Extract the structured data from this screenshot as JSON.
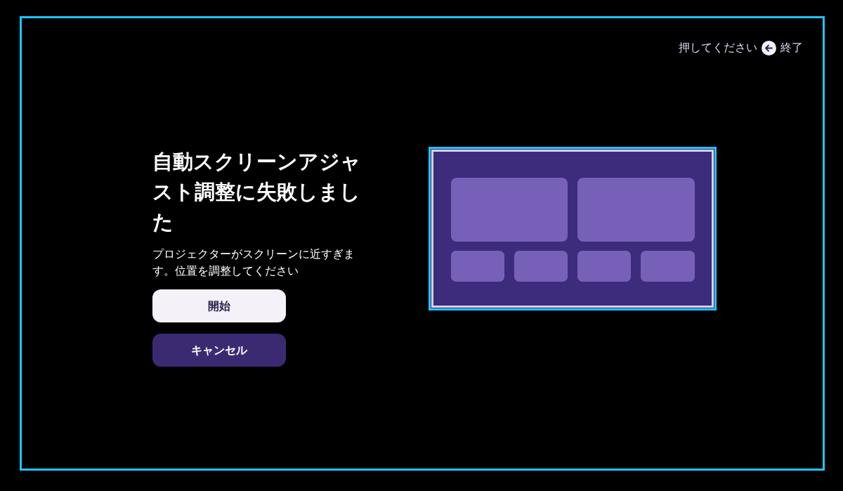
{
  "exit_hint": {
    "prompt": "押してください",
    "action": "終了"
  },
  "dialog": {
    "title": "自動スクリーンアジャスト調整に失敗しました",
    "message": "プロジェクターがスクリーンに近すぎます。位置を調整してください",
    "buttons": [
      {
        "label": "開始",
        "selected": true
      },
      {
        "label": "キャンセル",
        "selected": false
      }
    ]
  }
}
